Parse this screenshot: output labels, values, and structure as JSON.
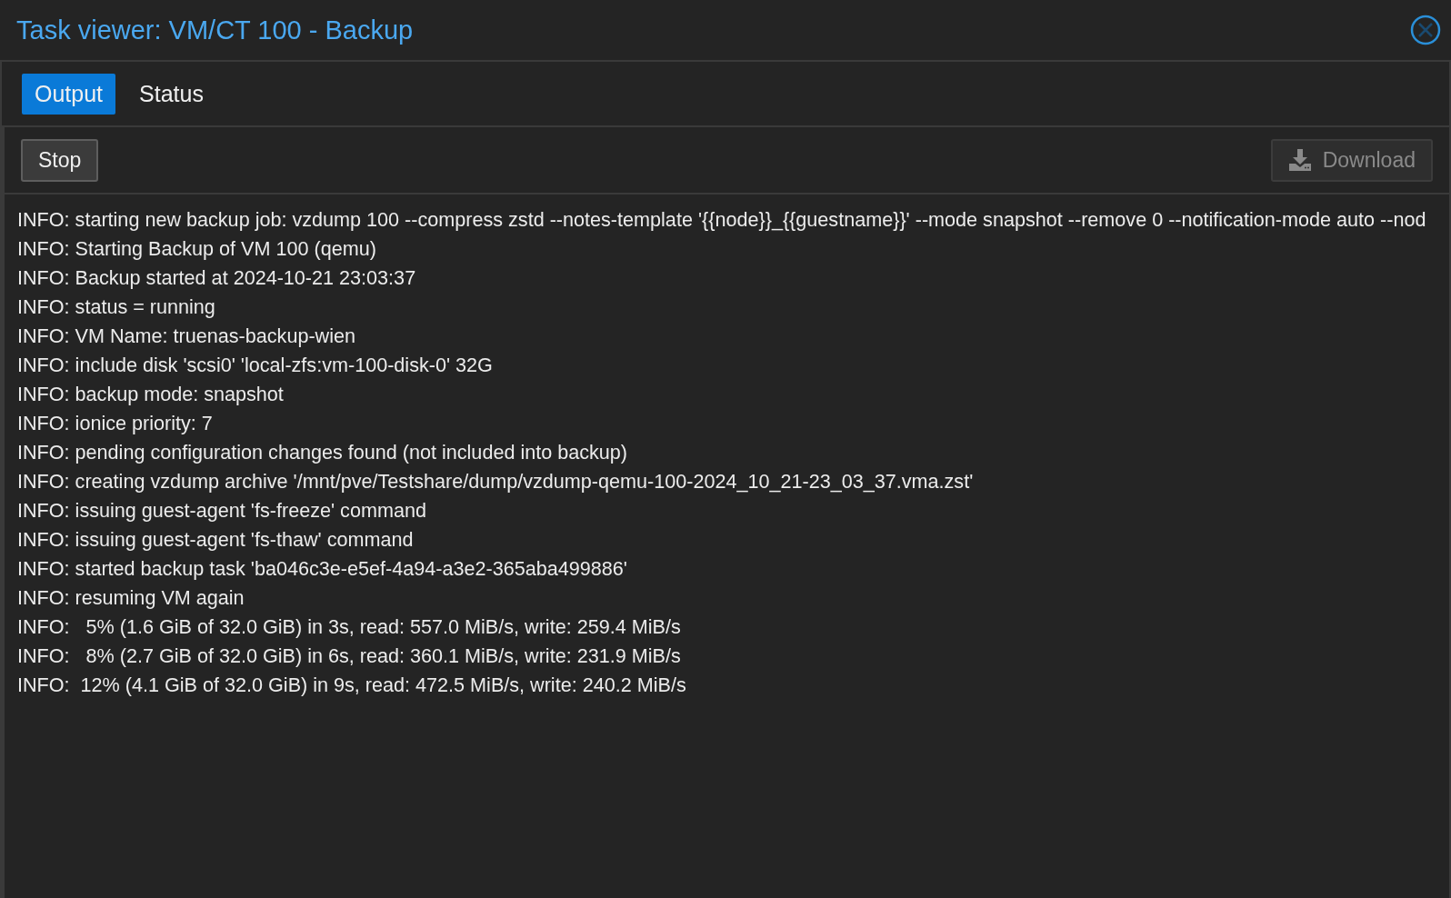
{
  "window": {
    "title": "Task viewer: VM/CT 100 - Backup"
  },
  "tabs": [
    {
      "label": "Output",
      "selected": true
    },
    {
      "label": "Status",
      "selected": false
    }
  ],
  "toolbar": {
    "buttons": [
      {
        "label": "Stop",
        "kind": "text",
        "disabled": false
      },
      {
        "label": "Download",
        "kind": "download",
        "disabled": true
      }
    ]
  },
  "log": [
    "INFO: starting new backup job: vzdump 100 --compress zstd --notes-template '{{node}}_{{guestname}}' --mode snapshot --remove 0 --notification-mode auto --nod",
    "INFO: Starting Backup of VM 100 (qemu)",
    "INFO: Backup started at 2024-10-21 23:03:37",
    "INFO: status = running",
    "INFO: VM Name: truenas-backup-wien",
    "INFO: include disk 'scsi0' 'local-zfs:vm-100-disk-0' 32G",
    "INFO: backup mode: snapshot",
    "INFO: ionice priority: 7",
    "INFO: pending configuration changes found (not included into backup)",
    "INFO: creating vzdump archive '/mnt/pve/Testshare/dump/vzdump-qemu-100-2024_10_21-23_03_37.vma.zst'",
    "INFO: issuing guest-agent 'fs-freeze' command",
    "INFO: issuing guest-agent 'fs-thaw' command",
    "INFO: started backup task 'ba046c3e-e5ef-4a94-a3e2-365aba499886'",
    "INFO: resuming VM again",
    "INFO:   5% (1.6 GiB of 32.0 GiB) in 3s, read: 557.0 MiB/s, write: 259.4 MiB/s",
    "INFO:   8% (2.7 GiB of 32.0 GiB) in 6s, read: 360.1 MiB/s, write: 231.9 MiB/s",
    "INFO:  12% (4.1 GiB of 32.0 GiB) in 9s, read: 472.5 MiB/s, write: 240.2 MiB/s"
  ]
}
